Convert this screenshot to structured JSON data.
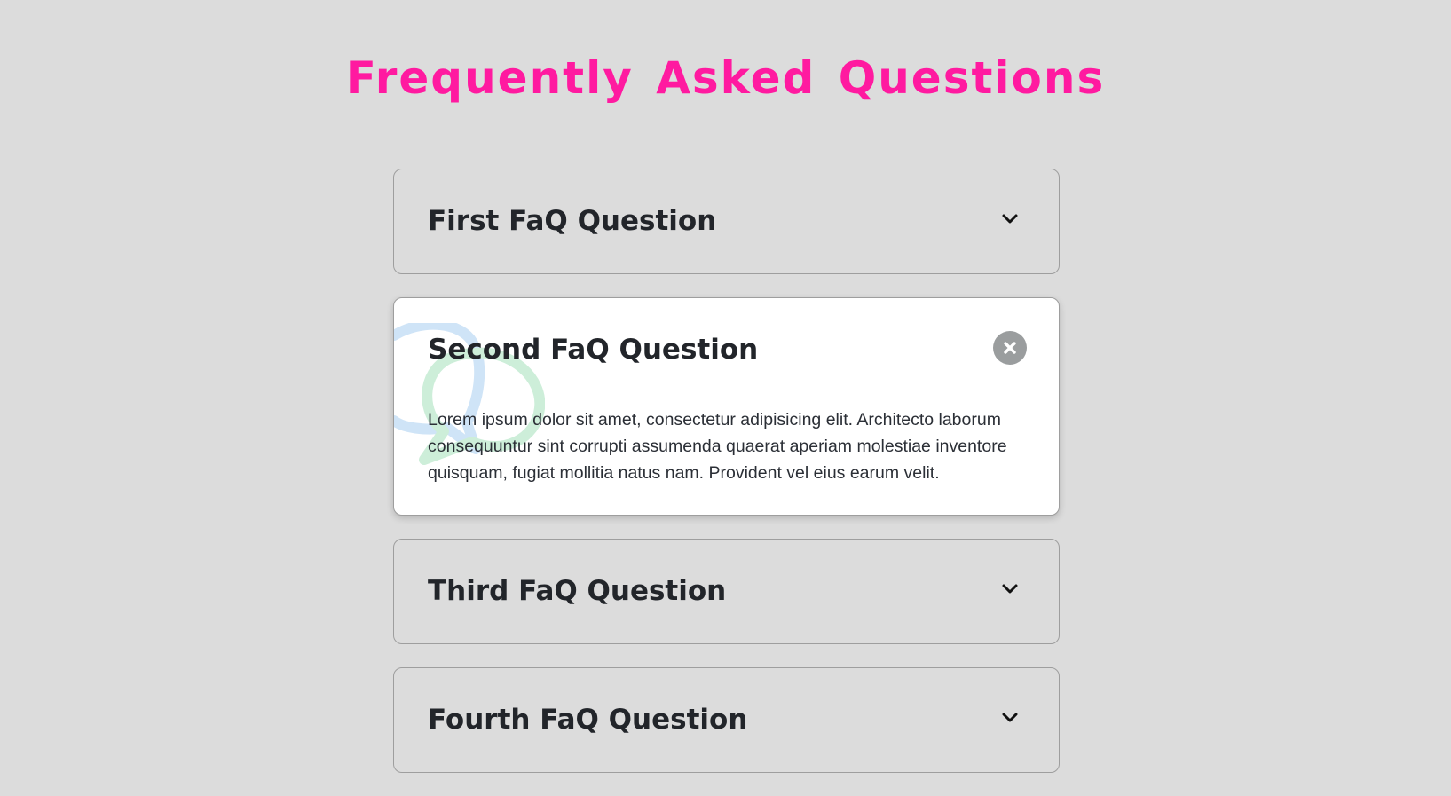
{
  "page": {
    "title": "Frequently Asked Questions"
  },
  "colors": {
    "background": "#dcdcdc",
    "title": "#ff1aa0",
    "card_active": "#ffffff",
    "close_button": "#9a9d9e",
    "bubble_blue": "#cfe4f7",
    "bubble_green": "#cdeed9"
  },
  "faqs": [
    {
      "question": "First FaQ Question",
      "expanded": false,
      "toggle_icon": "chevron-down-icon"
    },
    {
      "question": "Second FaQ Question",
      "answer": "Lorem ipsum dolor sit amet, consectetur adipisicing elit. Architecto laborum consequuntur sint corrupti assumenda quaerat aperiam molestiae inventore quisquam, fugiat mollitia natus nam. Provident vel eius earum velit.",
      "expanded": true,
      "toggle_icon": "close-icon",
      "decoration_icon": "chat-bubbles-icon"
    },
    {
      "question": "Third FaQ Question",
      "expanded": false,
      "toggle_icon": "chevron-down-icon"
    },
    {
      "question": "Fourth FaQ Question",
      "expanded": false,
      "toggle_icon": "chevron-down-icon"
    }
  ]
}
